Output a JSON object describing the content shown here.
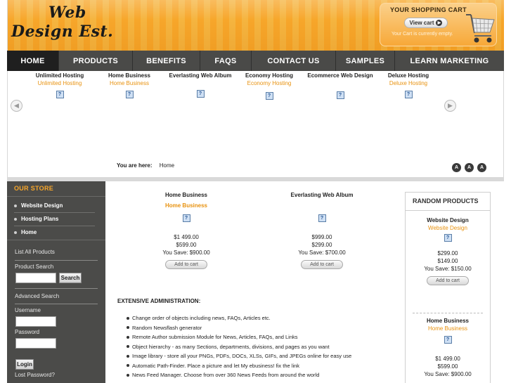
{
  "brand": {
    "logo_line1": "Web",
    "logo_line2": "Design Est."
  },
  "cart": {
    "title": "YOUR SHOPPING CART",
    "view_label": "View cart",
    "status": "Your Cart is currently empty."
  },
  "nav": {
    "items": [
      {
        "label": "HOME",
        "active": true
      },
      {
        "label": "PRODUCTS"
      },
      {
        "label": "BENEFITS"
      },
      {
        "label": "FAQS"
      },
      {
        "label": "CONTACT US"
      },
      {
        "label": "SAMPLES"
      },
      {
        "label": "LEARN MARKETING"
      }
    ]
  },
  "slider": {
    "items": [
      {
        "title": "Unlimited Hosting",
        "sub": "Unlimited Hosting",
        "img": "?"
      },
      {
        "title": "Home Business",
        "sub": "Home Business",
        "img": "?"
      },
      {
        "title": "Everlasting Web Album",
        "sub": "",
        "img": "?"
      },
      {
        "title": "Economy Hosting",
        "sub": "Economy Hosting",
        "img": "?"
      },
      {
        "title": "Ecommerce Web Design",
        "sub": "",
        "img": "?"
      },
      {
        "title": "Deluxe Hosting",
        "sub": "Deluxe Hosting",
        "img": "?"
      }
    ],
    "prev": "◀",
    "next": "▶"
  },
  "breadcrumb": {
    "label": "You are here:",
    "current": "Home"
  },
  "font_controls": [
    "A",
    "A",
    "A"
  ],
  "sidebar": {
    "title": "OUR STORE",
    "items": [
      "Website Design",
      "Hosting Plans",
      "Home"
    ],
    "list_all": "List All Products",
    "search_label": "Product Search",
    "search_button": "Search",
    "advanced_search": "Advanced Search",
    "username_label": "Username",
    "password_label": "Password",
    "login_button": "Login",
    "lost_password": "Lost Password?"
  },
  "featured": [
    {
      "title": "Home Business",
      "sub": "Home Business",
      "img": "?",
      "price": "$1 499.00",
      "old": "$599.00",
      "save": "You Save: $900.00",
      "button": "Add to cart"
    },
    {
      "title": "Everlasting Web Album",
      "sub": "",
      "img": "?",
      "price": "$999.00",
      "old": "$299.00",
      "save": "You Save: $700.00",
      "button": "Add to cart"
    }
  ],
  "admin": {
    "title": "EXTENSIVE ADMINISTRATION:",
    "features": [
      "Change order of objects including news, FAQs, Articles etc.",
      "Random Newsflash generator",
      "Remote Author submission Module for News, Articles, FAQs, and Links",
      "Object hierarchy - as many Sections, departments, divisions, and pages as you want",
      "Image library - store all your PNGs, PDFs, DOCs, XLSs, GIFs, and JPEGs online for easy use",
      "Automatic Path-Finder. Place a picture and let My ebusiness! fix the link",
      "News Feed Manager. Choose from over 360 News Feeds from around the world"
    ]
  },
  "random": {
    "title": "RANDOM PRODUCTS",
    "items": [
      {
        "title": "Website Design",
        "sub": "Website Design",
        "img": "?",
        "price": "$299.00",
        "old": "$149.00",
        "save": "You Save: $150.00",
        "button": "Add to cart"
      },
      {
        "title": "Home Business",
        "sub": "Home Business",
        "img": "?",
        "price": "$1 499.00",
        "old": "$599.00",
        "save": "You Save: $900.00"
      }
    ]
  },
  "colors": {
    "accent": "#f7a62a",
    "nav_bg": "#4a4a48",
    "nav_active": "#1f1f1f",
    "link": "#e8920f"
  }
}
